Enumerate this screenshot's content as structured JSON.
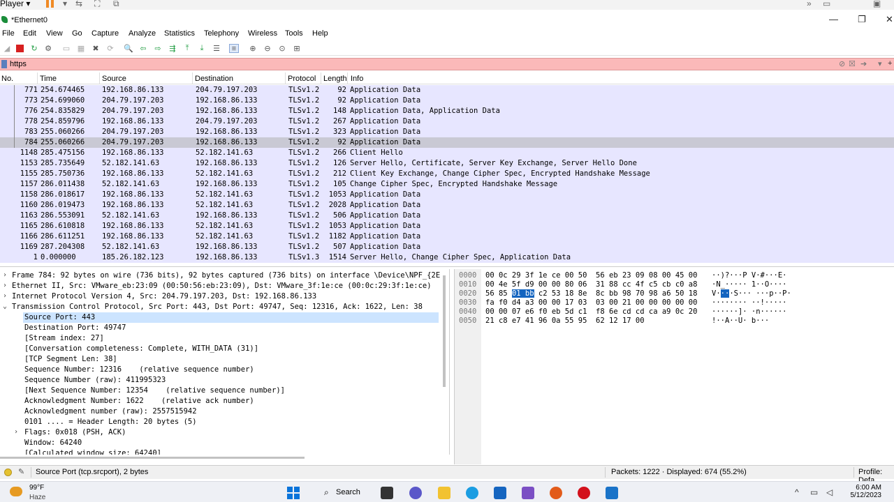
{
  "vm": {
    "player_label": "Player ▾"
  },
  "window": {
    "title": "*Ethernet0",
    "minimize": "—",
    "maximize": "❐",
    "close": "✕"
  },
  "menu": [
    "File",
    "Edit",
    "View",
    "Go",
    "Capture",
    "Analyze",
    "Statistics",
    "Telephony",
    "Wireless",
    "Tools",
    "Help"
  ],
  "filter": {
    "value": "https",
    "bg_color": "#fbb9b9"
  },
  "columns": {
    "no": "No.",
    "time": "Time",
    "source": "Source",
    "destination": "Destination",
    "protocol": "Protocol",
    "length": "Length",
    "info": "Info"
  },
  "packets": [
    {
      "no": "771",
      "time": "254.674465",
      "src": "192.168.86.133",
      "dst": "204.79.197.203",
      "proto": "TLSv1.2",
      "len": "92",
      "info": "Application Data"
    },
    {
      "no": "773",
      "time": "254.699060",
      "src": "204.79.197.203",
      "dst": "192.168.86.133",
      "proto": "TLSv1.2",
      "len": "92",
      "info": "Application Data"
    },
    {
      "no": "776",
      "time": "254.835829",
      "src": "204.79.197.203",
      "dst": "192.168.86.133",
      "proto": "TLSv1.2",
      "len": "148",
      "info": "Application Data, Application Data"
    },
    {
      "no": "778",
      "time": "254.859796",
      "src": "192.168.86.133",
      "dst": "204.79.197.203",
      "proto": "TLSv1.2",
      "len": "267",
      "info": "Application Data"
    },
    {
      "no": "783",
      "time": "255.060266",
      "src": "204.79.197.203",
      "dst": "192.168.86.133",
      "proto": "TLSv1.2",
      "len": "323",
      "info": "Application Data"
    },
    {
      "no": "784",
      "time": "255.060266",
      "src": "204.79.197.203",
      "dst": "192.168.86.133",
      "proto": "TLSv1.2",
      "len": "92",
      "info": "Application Data"
    },
    {
      "no": "1148",
      "time": "285.475156",
      "src": "192.168.86.133",
      "dst": "52.182.141.63",
      "proto": "TLSv1.2",
      "len": "266",
      "info": "Client Hello"
    },
    {
      "no": "1153",
      "time": "285.735649",
      "src": "52.182.141.63",
      "dst": "192.168.86.133",
      "proto": "TLSv1.2",
      "len": "126",
      "info": "Server Hello, Certificate, Server Key Exchange, Server Hello Done"
    },
    {
      "no": "1155",
      "time": "285.750736",
      "src": "192.168.86.133",
      "dst": "52.182.141.63",
      "proto": "TLSv1.2",
      "len": "212",
      "info": "Client Key Exchange, Change Cipher Spec, Encrypted Handshake Message"
    },
    {
      "no": "1157",
      "time": "286.011438",
      "src": "52.182.141.63",
      "dst": "192.168.86.133",
      "proto": "TLSv1.2",
      "len": "105",
      "info": "Change Cipher Spec, Encrypted Handshake Message"
    },
    {
      "no": "1158",
      "time": "286.018617",
      "src": "192.168.86.133",
      "dst": "52.182.141.63",
      "proto": "TLSv1.2",
      "len": "1053",
      "info": "Application Data"
    },
    {
      "no": "1160",
      "time": "286.019473",
      "src": "192.168.86.133",
      "dst": "52.182.141.63",
      "proto": "TLSv1.2",
      "len": "2028",
      "info": "Application Data"
    },
    {
      "no": "1163",
      "time": "286.553091",
      "src": "52.182.141.63",
      "dst": "192.168.86.133",
      "proto": "TLSv1.2",
      "len": "506",
      "info": "Application Data"
    },
    {
      "no": "1165",
      "time": "286.610818",
      "src": "192.168.86.133",
      "dst": "52.182.141.63",
      "proto": "TLSv1.2",
      "len": "1053",
      "info": "Application Data"
    },
    {
      "no": "1166",
      "time": "286.611251",
      "src": "192.168.86.133",
      "dst": "52.182.141.63",
      "proto": "TLSv1.2",
      "len": "1182",
      "info": "Application Data"
    },
    {
      "no": "1169",
      "time": "287.204308",
      "src": "52.182.141.63",
      "dst": "192.168.86.133",
      "proto": "TLSv1.2",
      "len": "507",
      "info": "Application Data"
    },
    {
      "no": "1",
      "time": "0.000000",
      "src": "185.26.182.123",
      "dst": "192.168.86.133",
      "proto": "TLSv1.3",
      "len": "1514",
      "info": "Server Hello, Change Cipher Spec, Application Data"
    }
  ],
  "selected_packet": "784",
  "details": [
    {
      "indent": 0,
      "arrow": "›",
      "text": "Frame 784: 92 bytes on wire (736 bits), 92 bytes captured (736 bits) on interface \\Device\\NPF_{2E"
    },
    {
      "indent": 0,
      "arrow": "›",
      "text": "Ethernet II, Src: VMware_eb:23:09 (00:50:56:eb:23:09), Dst: VMware_3f:1e:ce (00:0c:29:3f:1e:ce)"
    },
    {
      "indent": 0,
      "arrow": "›",
      "text": "Internet Protocol Version 4, Src: 204.79.197.203, Dst: 192.168.86.133"
    },
    {
      "indent": 0,
      "arrow": "⌄",
      "text": "Transmission Control Protocol, Src Port: 443, Dst Port: 49747, Seq: 12316, Ack: 1622, Len: 38"
    },
    {
      "indent": 1,
      "arrow": "",
      "text": "Source Port: 443",
      "hl": true
    },
    {
      "indent": 1,
      "arrow": "",
      "text": "Destination Port: 49747"
    },
    {
      "indent": 1,
      "arrow": "",
      "text": "[Stream index: 27]"
    },
    {
      "indent": 1,
      "arrow": "",
      "text": "[Conversation completeness: Complete, WITH_DATA (31)]"
    },
    {
      "indent": 1,
      "arrow": "",
      "text": "[TCP Segment Len: 38]"
    },
    {
      "indent": 1,
      "arrow": "",
      "text": "Sequence Number: 12316    (relative sequence number)"
    },
    {
      "indent": 1,
      "arrow": "",
      "text": "Sequence Number (raw): 411995323"
    },
    {
      "indent": 1,
      "arrow": "",
      "text": "[Next Sequence Number: 12354    (relative sequence number)]"
    },
    {
      "indent": 1,
      "arrow": "",
      "text": "Acknowledgment Number: 1622    (relative ack number)"
    },
    {
      "indent": 1,
      "arrow": "",
      "text": "Acknowledgment number (raw): 2557515942"
    },
    {
      "indent": 1,
      "arrow": "",
      "text": "0101 .... = Header Length: 20 bytes (5)"
    },
    {
      "indent": 1,
      "arrow": "›",
      "text": "Flags: 0x018 (PSH, ACK)"
    },
    {
      "indent": 1,
      "arrow": "",
      "text": "Window: 64240"
    },
    {
      "indent": 1,
      "arrow": "",
      "text": "[Calculated window size: 64240]"
    }
  ],
  "bytes": [
    {
      "off": "0000",
      "pre": "00 0c 29 3f 1e ce 00 50  56 eb 23 09 08 00 45 00",
      "hl": "",
      "post": "",
      "ascii_pre": "··)?···P V·#···E·",
      "ascii_hl": "",
      "ascii_post": ""
    },
    {
      "off": "0010",
      "pre": "00 4e 5f d9 00 00 80 06  31 88 cc 4f c5 cb c0 a8",
      "hl": "",
      "post": "",
      "ascii_pre": "·N_····· 1··O····",
      "ascii_hl": "",
      "ascii_post": ""
    },
    {
      "off": "0020",
      "pre": "56 85 ",
      "hl": "01 bb",
      "post": " c2 53 18 8e  8c bb 98 70 98 a6 50 18",
      "ascii_pre": "V·",
      "ascii_hl": "··",
      "ascii_post": "·S··· ···p··P·"
    },
    {
      "off": "0030",
      "pre": "fa f0 d4 a3 00 00 17 03  03 00 21 00 00 00 00 00",
      "hl": "",
      "post": "",
      "ascii_pre": "········ ··!·····",
      "ascii_hl": "",
      "ascii_post": ""
    },
    {
      "off": "0040",
      "pre": "00 00 07 e6 f0 eb 5d c1  f8 6e cd cd ca a9 0c 20",
      "hl": "",
      "post": "",
      "ascii_pre": "······]· ·n······ ",
      "ascii_hl": "",
      "ascii_post": ""
    },
    {
      "off": "0050",
      "pre": "21 c8 e7 41 96 0a 55 95  62 12 17 00",
      "hl": "",
      "post": "",
      "ascii_pre": "!··A··U· b···",
      "ascii_hl": "",
      "ascii_post": ""
    }
  ],
  "status": {
    "field": "Source Port (tcp.srcport), 2 bytes",
    "packets": "Packets: 1222 · Displayed: 674 (55.2%)",
    "profile": "Profile: Defa"
  },
  "taskbar": {
    "weather_temp": "99°F",
    "weather_desc": "Haze",
    "search": "Search",
    "time": "6:00 AM",
    "date": "5/12/2023"
  }
}
